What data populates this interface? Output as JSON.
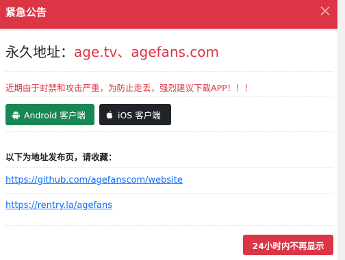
{
  "header": {
    "title": "紧急公告",
    "close_icon": "close-icon"
  },
  "notice": {
    "domain_label": "永久地址：",
    "domain_sites": "age.tv、agefans.com",
    "warning": "近期由于封禁和攻击严重，为防止走丢，强烈建议下载APP！！！"
  },
  "apps": [
    {
      "label": "Android 客户端",
      "icon": "android-icon",
      "color": "#198754"
    },
    {
      "label": "iOS 客户端",
      "icon": "apple-icon",
      "color": "#212529"
    }
  ],
  "publish": {
    "title": "以下为地址发布页，请收藏：",
    "links": [
      "https://github.com/agefanscom/website",
      "https://rentry.la/agefans"
    ]
  },
  "footer": {
    "dismiss_label": "24小时内不再显示"
  },
  "colors": {
    "accent": "#dc3545",
    "link": "#0d6efd",
    "android": "#198754",
    "ios": "#212529"
  }
}
